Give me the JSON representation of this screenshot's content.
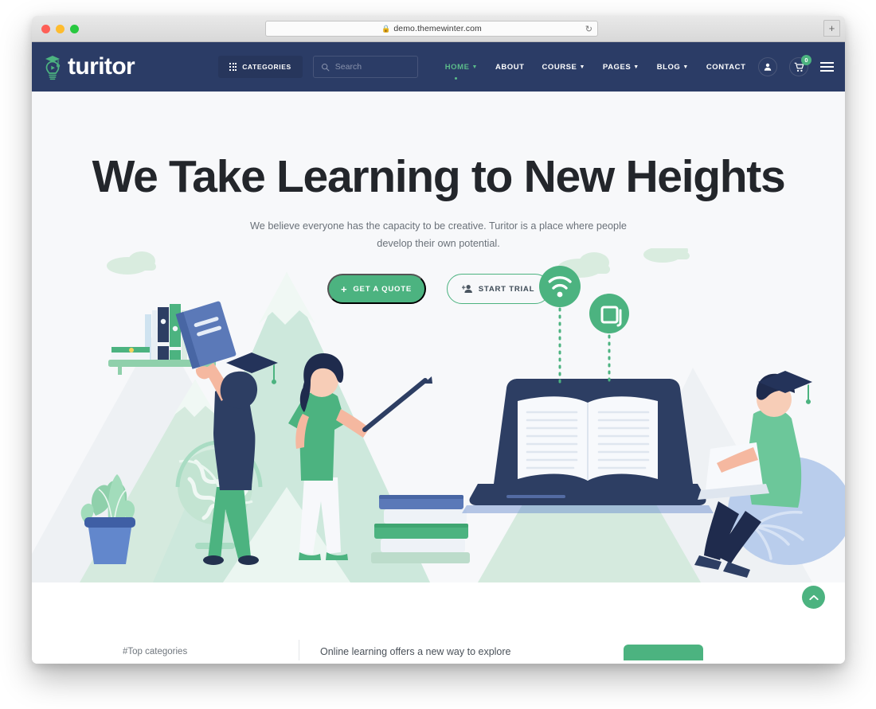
{
  "browser": {
    "url": "demo.themewinter.com",
    "lock_icon": "lock-icon",
    "reload_icon": "reload-icon",
    "new_tab_label": "+",
    "traffic_lights": [
      "close",
      "minimize",
      "zoom"
    ]
  },
  "navbar": {
    "logo_text": "turitor",
    "logo_icon": "graduation-lightbulb-icon",
    "categories": {
      "label": "CATEGORIES",
      "icon": "grid-dots-icon"
    },
    "search": {
      "placeholder": "Search",
      "icon": "search-icon"
    },
    "menu": [
      {
        "label": "HOME",
        "has_caret": true,
        "active": true
      },
      {
        "label": "ABOUT",
        "has_caret": false,
        "active": false
      },
      {
        "label": "COURSE",
        "has_caret": true,
        "active": false
      },
      {
        "label": "PAGES",
        "has_caret": true,
        "active": false
      },
      {
        "label": "BLOG",
        "has_caret": true,
        "active": false
      },
      {
        "label": "CONTACT",
        "has_caret": false,
        "active": false
      }
    ],
    "account_icon": "user-icon",
    "cart_icon": "shopping-cart-icon",
    "cart_count": "0",
    "menu_toggle_icon": "hamburger-icon"
  },
  "hero": {
    "title": "We Take Learning to New Heights",
    "subtitle": "We believe everyone has the capacity to be creative. Turitor is a place where people develop their own potential.",
    "primary_cta": {
      "label": "GET A QUOTE",
      "icon": "plus-icon"
    },
    "secondary_cta": {
      "label": "START TRIAL",
      "icon": "add-user-icon"
    },
    "illustration": {
      "name": "online-learning-illustration",
      "elements": [
        "mountains",
        "clouds",
        "bookshelf",
        "potted-plant",
        "globe",
        "student-holding-book",
        "teacher-with-pointer",
        "stacked-books",
        "laptop-with-open-book",
        "wifi-badge",
        "window-badge",
        "student-on-beanbag-with-laptop"
      ]
    }
  },
  "lower": {
    "top_categories_label": "#Top categories",
    "tagline": "Online learning offers a new way to explore",
    "scroll_top_icon": "chevron-up-icon"
  },
  "colors": {
    "navy": "#2b3c66",
    "navy_dark": "#27365c",
    "green": "#4cb380",
    "green_light": "#5bbb8a",
    "hero_bg": "#f7f8fa",
    "mint": "#d5eade",
    "heading": "#23262b",
    "body_text": "#6a7179"
  }
}
